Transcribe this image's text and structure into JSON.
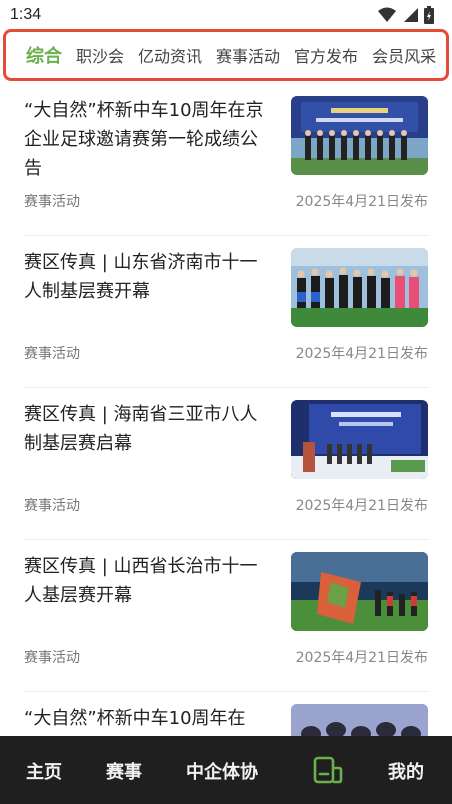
{
  "status": {
    "time": "1:34"
  },
  "tabs": [
    "综合",
    "职沙会",
    "亿动资讯",
    "赛事活动",
    "官方发布",
    "会员风采"
  ],
  "news": [
    {
      "title": "“大自然”杯新中车10周年在京企业足球邀请赛第一轮成绩公告",
      "category": "赛事活动",
      "date": "2025年4月21日发布"
    },
    {
      "title": "赛区传真 | 山东省济南市十一人制基层赛开幕",
      "category": "赛事活动",
      "date": "2025年4月21日发布"
    },
    {
      "title": "赛区传真 | 海南省三亚市八人制基层赛启幕",
      "category": "赛事活动",
      "date": "2025年4月21日发布"
    },
    {
      "title": "赛区传真 | 山西省长治市十一人基层赛开幕",
      "category": "赛事活动",
      "date": "2025年4月21日发布"
    },
    {
      "title": "“大自然”杯新中车10周年在",
      "category": "",
      "date": ""
    }
  ],
  "nav": {
    "home": "主页",
    "events": "赛事",
    "association": "中企体协",
    "news_icon": "news-icon",
    "mine": "我的",
    "active_color": "#6ab04c"
  },
  "colors": {
    "accent": "#6ab04c",
    "highlight_border": "#e64b35"
  }
}
